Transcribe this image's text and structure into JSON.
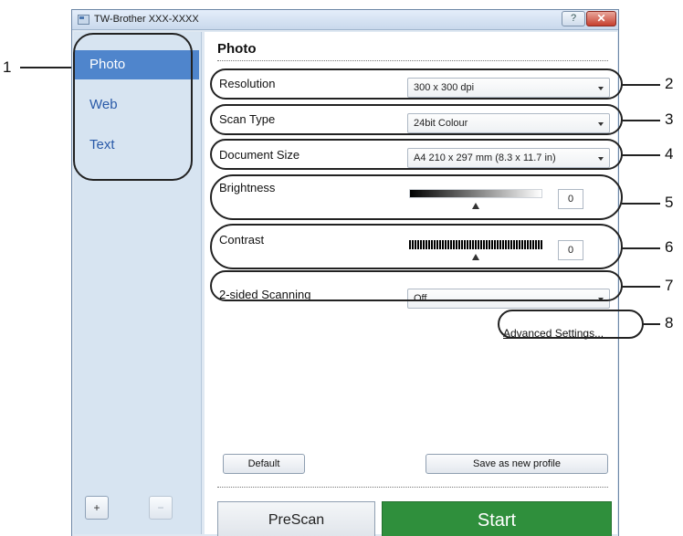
{
  "window": {
    "title": "TW-Brother XXX-XXXX",
    "help_glyph": "?",
    "close_glyph": "✕"
  },
  "sidebar": {
    "items": [
      {
        "label": "Photo",
        "active": true
      },
      {
        "label": "Web",
        "active": false
      },
      {
        "label": "Text",
        "active": false
      }
    ],
    "add_label": "+",
    "remove_label": "−"
  },
  "content": {
    "title": "Photo",
    "resolution": {
      "label": "Resolution",
      "value": "300 x 300 dpi"
    },
    "scan_type": {
      "label": "Scan Type",
      "value": "24bit Colour"
    },
    "document_size": {
      "label": "Document Size",
      "value": "A4 210 x 297 mm (8.3 x 11.7 in)"
    },
    "brightness": {
      "label": "Brightness",
      "value": "0",
      "level": 0.5
    },
    "contrast": {
      "label": "Contrast",
      "value": "0",
      "level": 0.5
    },
    "two_sided": {
      "label": "2-sided Scanning",
      "value": "Off"
    },
    "advanced_settings": "Advanced Settings...",
    "default_button": "Default",
    "save_profile_button": "Save as new profile",
    "prescan_button": "PreScan",
    "start_button": "Start"
  },
  "callouts": [
    "1",
    "2",
    "3",
    "4",
    "5",
    "6",
    "7",
    "8"
  ],
  "colors": {
    "accent": "#4f85cc",
    "start": "#2f8f3c",
    "sidebar_bg": "#d7e4f1"
  }
}
